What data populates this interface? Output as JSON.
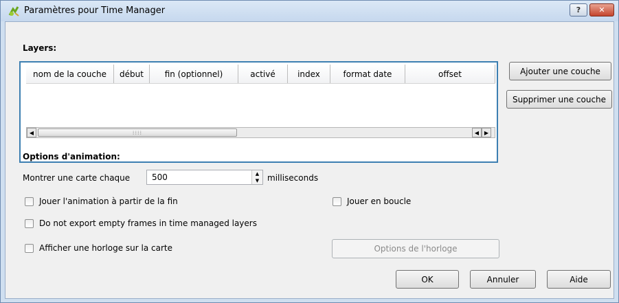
{
  "window": {
    "title": "Paramètres pour Time Manager",
    "help_label": "?",
    "close_label": "✕"
  },
  "layers": {
    "title": "Layers:",
    "columns": [
      "nom de la couche",
      "début",
      "fin (optionnel)",
      "activé",
      "index",
      "format date",
      "offset"
    ],
    "add_button": "Ajouter une couche",
    "remove_button": "Supprimer une couche",
    "scroll_left": "◀",
    "scroll_right": "▶",
    "scroll_grip": "⁞⁞⁞⁞"
  },
  "animation": {
    "title": "Options d'animation:",
    "show_map_label": "Montrer une carte chaque",
    "interval_value": "500",
    "unit_label": "milliseconds",
    "spin_up": "▲",
    "spin_down": "▼",
    "play_backwards_label": "Jouer l'animation à partir de la fin",
    "loop_label": "Jouer en boucle",
    "no_empty_frames_label": "Do not export empty frames in time managed layers",
    "show_clock_label": "Afficher une horloge sur la carte",
    "clock_options_button": "Options de l'horloge"
  },
  "footer": {
    "ok": "OK",
    "cancel": "Annuler",
    "help": "Aide"
  },
  "colors": {
    "accent_border": "#3c7fb1",
    "title_bar": "#c6d8ee",
    "close_red": "#c4452e"
  }
}
